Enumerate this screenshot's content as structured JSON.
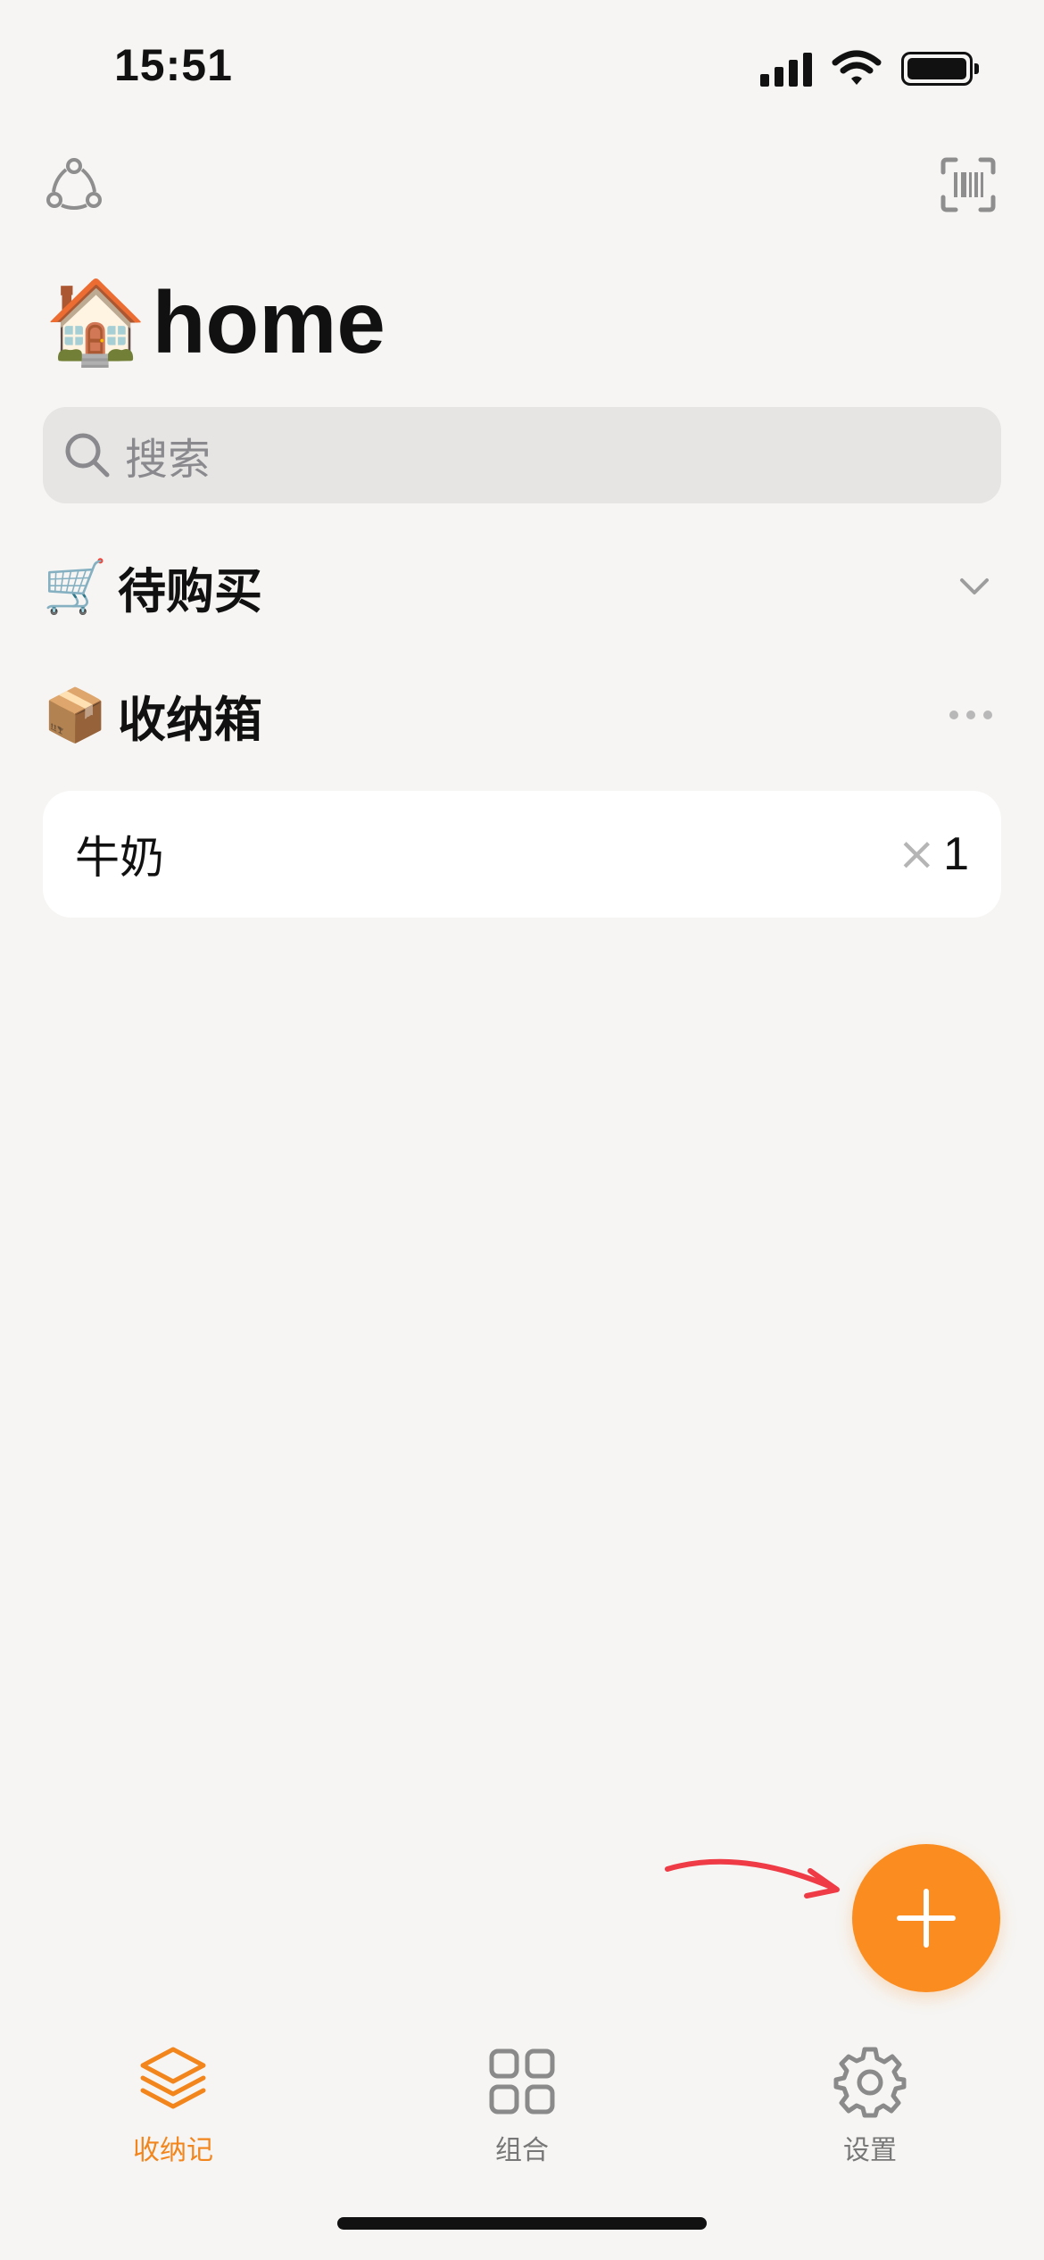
{
  "status_bar": {
    "time": "15:51"
  },
  "header": {
    "emoji": "🏠",
    "title": "home"
  },
  "search": {
    "placeholder": "搜索"
  },
  "sections": [
    {
      "emoji": "🛒",
      "label": "待购买",
      "trail_icon": "chevron-down-icon"
    },
    {
      "emoji": "📦",
      "label": "收纳箱",
      "trail_icon": "more-icon"
    }
  ],
  "items": [
    {
      "name": "牛奶",
      "times": "×",
      "quantity": "1"
    }
  ],
  "tabs": [
    {
      "label": "收纳记",
      "icon": "stack-layers-icon",
      "active": true
    },
    {
      "label": "组合",
      "icon": "grid-icon",
      "active": false
    },
    {
      "label": "设置",
      "icon": "gear-icon",
      "active": false
    }
  ],
  "colors": {
    "accent": "#fb8c1f",
    "background": "#f6f5f3",
    "search_bg": "#e6e5e3",
    "arrow": "#ef3b45"
  }
}
